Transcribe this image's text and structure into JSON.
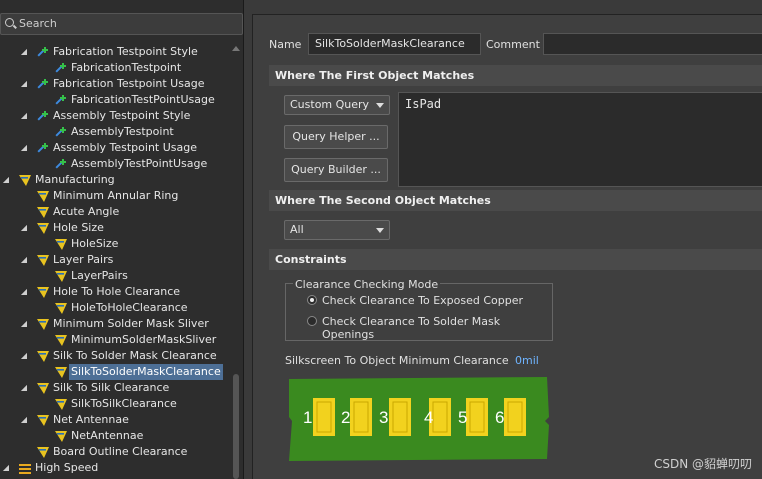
{
  "search": {
    "placeholder": "Search"
  },
  "tree": [
    {
      "label": "Fabrication Testpoint Style",
      "level": 2,
      "icon": "test",
      "arrow": "◢"
    },
    {
      "label": "FabricationTestpoint",
      "level": 3,
      "icon": "test",
      "arrow": ""
    },
    {
      "label": "Fabrication Testpoint Usage",
      "level": 2,
      "icon": "test",
      "arrow": "◢"
    },
    {
      "label": "FabricationTestPointUsage",
      "level": 3,
      "icon": "test",
      "arrow": ""
    },
    {
      "label": "Assembly Testpoint Style",
      "level": 2,
      "icon": "test",
      "arrow": "◢"
    },
    {
      "label": "AssemblyTestpoint",
      "level": 3,
      "icon": "test",
      "arrow": ""
    },
    {
      "label": "Assembly Testpoint Usage",
      "level": 2,
      "icon": "test",
      "arrow": "◢"
    },
    {
      "label": "AssemblyTestPointUsage",
      "level": 3,
      "icon": "test",
      "arrow": ""
    },
    {
      "label": "Manufacturing",
      "level": 1,
      "icon": "mfg",
      "arrow": "◢"
    },
    {
      "label": "Minimum Annular Ring",
      "level": 2,
      "icon": "mfg",
      "arrow": ""
    },
    {
      "label": "Acute Angle",
      "level": 2,
      "icon": "mfg",
      "arrow": ""
    },
    {
      "label": "Hole Size",
      "level": 2,
      "icon": "mfg",
      "arrow": "◢"
    },
    {
      "label": "HoleSize",
      "level": 3,
      "icon": "mfg",
      "arrow": ""
    },
    {
      "label": "Layer Pairs",
      "level": 2,
      "icon": "mfg",
      "arrow": "◢"
    },
    {
      "label": "LayerPairs",
      "level": 3,
      "icon": "mfg",
      "arrow": ""
    },
    {
      "label": "Hole To Hole Clearance",
      "level": 2,
      "icon": "mfg",
      "arrow": "◢"
    },
    {
      "label": "HoleToHoleClearance",
      "level": 3,
      "icon": "mfg",
      "arrow": ""
    },
    {
      "label": "Minimum Solder Mask Sliver",
      "level": 2,
      "icon": "mfg",
      "arrow": "◢"
    },
    {
      "label": "MinimumSolderMaskSliver",
      "level": 3,
      "icon": "mfg",
      "arrow": ""
    },
    {
      "label": "Silk To Solder Mask Clearance",
      "level": 2,
      "icon": "mfg",
      "arrow": "◢"
    },
    {
      "label": "SilkToSolderMaskClearance",
      "level": 3,
      "icon": "mfg",
      "arrow": "",
      "selected": true
    },
    {
      "label": "Silk To Silk Clearance",
      "level": 2,
      "icon": "mfg",
      "arrow": "◢"
    },
    {
      "label": "SilkToSilkClearance",
      "level": 3,
      "icon": "mfg",
      "arrow": ""
    },
    {
      "label": "Net Antennae",
      "level": 2,
      "icon": "mfg",
      "arrow": "◢"
    },
    {
      "label": "NetAntennae",
      "level": 3,
      "icon": "mfg",
      "arrow": ""
    },
    {
      "label": "Board Outline Clearance",
      "level": 2,
      "icon": "mfg",
      "arrow": ""
    },
    {
      "label": "High Speed",
      "level": 1,
      "icon": "hs",
      "arrow": "◢"
    }
  ],
  "form": {
    "name_label": "Name",
    "name_value": "SilkToSolderMaskClearance",
    "comment_label": "Comment",
    "comment_value": "",
    "first_match_title": "Where The First Object Matches",
    "first_match_select": "Custom Query",
    "query_helper": "Query Helper ...",
    "query_builder": "Query Builder ...",
    "query_text": "IsPad",
    "second_match_title": "Where The Second Object Matches",
    "second_match_select": "All",
    "constraints_title": "Constraints",
    "mode_title": "Clearance Checking Mode",
    "mode_options": [
      {
        "label": "Check Clearance To Exposed Copper",
        "checked": true
      },
      {
        "label": "Check Clearance To Solder Mask Openings",
        "checked": false
      }
    ],
    "min_clearance_label": "Silkscreen To Object Minimum Clearance",
    "min_clearance_value": "0mil",
    "pad_numbers": [
      "1",
      "2",
      "3",
      "4",
      "5",
      "6"
    ]
  },
  "colors": {
    "board": "#3a8a1f",
    "pad": "#f2d21e",
    "selection": "#4d6f96",
    "accent": "#6fb4ff"
  },
  "watermark": "CSDN @貂蝉叨叨"
}
